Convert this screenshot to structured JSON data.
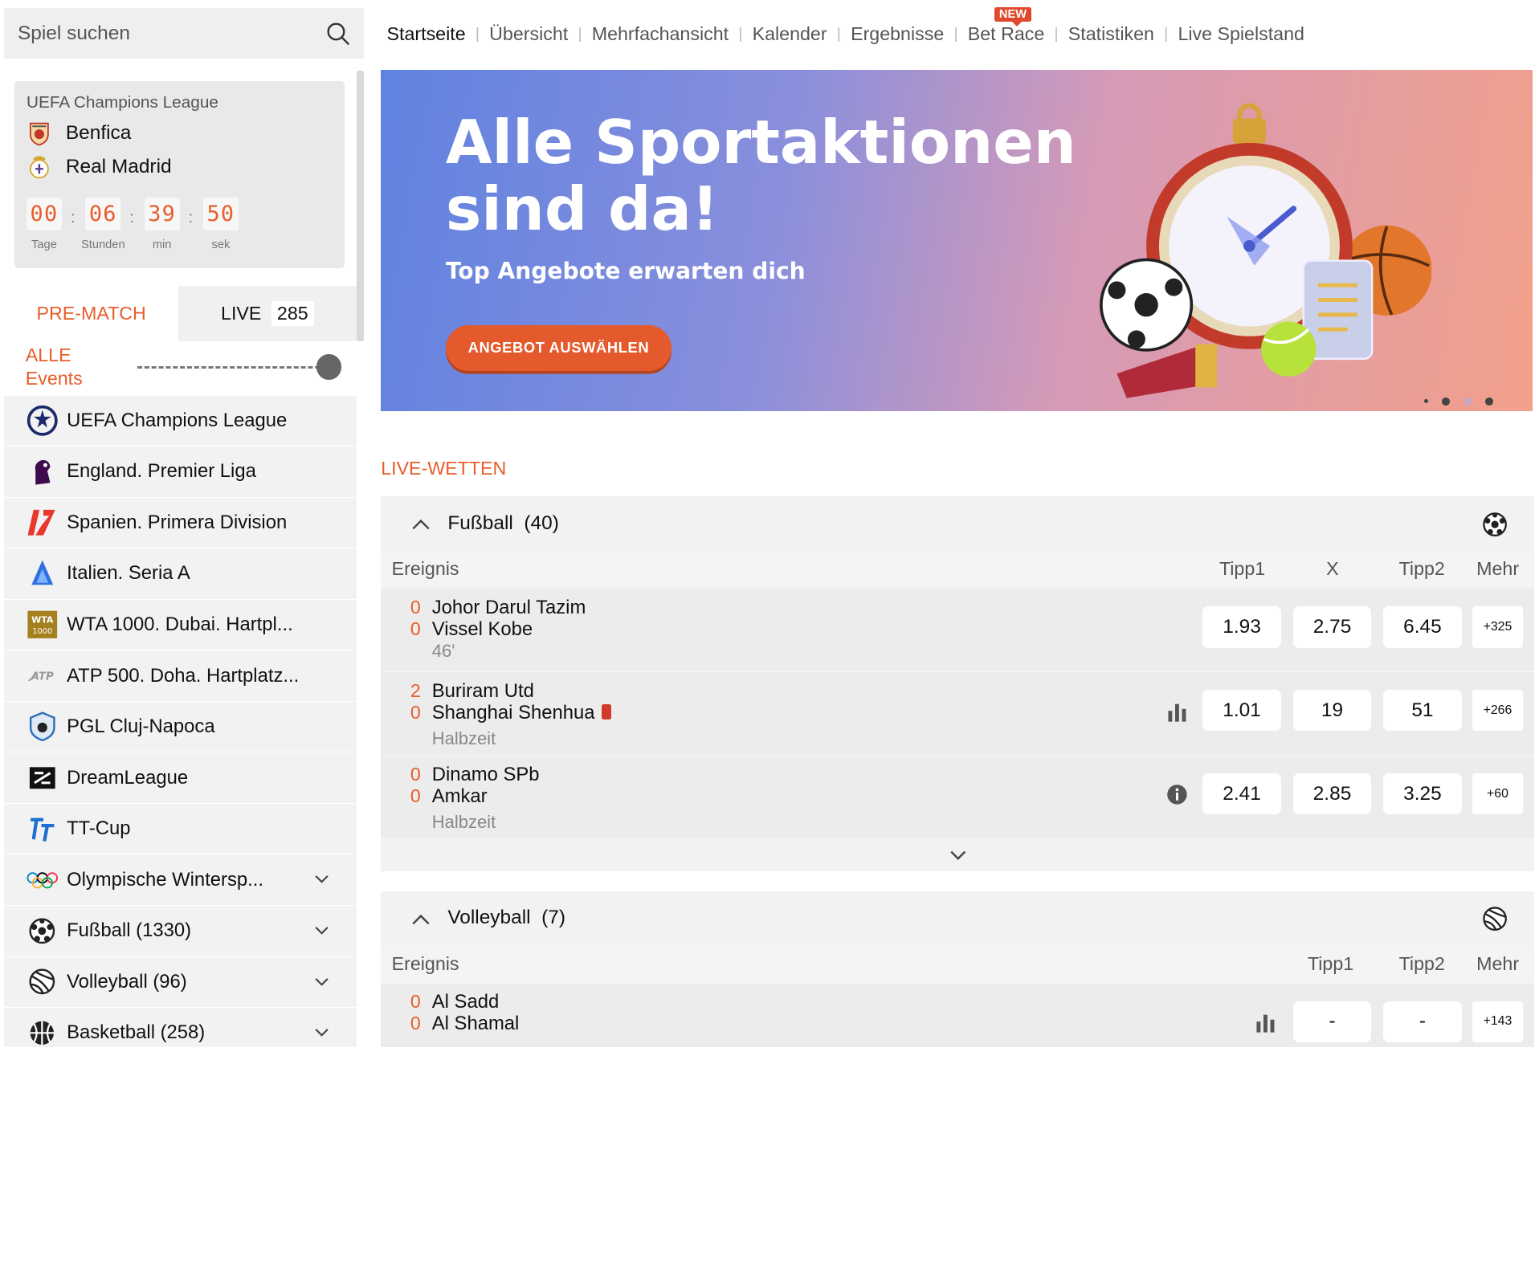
{
  "search": {
    "placeholder": "Spiel suchen"
  },
  "featured_match": {
    "league": "UEFA Champions League",
    "team1": "Benfica",
    "team2": "Real Madrid",
    "countdown": [
      {
        "value": "00",
        "label": "Tage"
      },
      {
        "value": "06",
        "label": "Stunden"
      },
      {
        "value": "39",
        "label": "min"
      },
      {
        "value": "50",
        "label": "sek"
      }
    ],
    "separator": ":"
  },
  "tabs": {
    "prematch": "PRE-MATCH",
    "live": "LIVE",
    "live_count": "285"
  },
  "filter": {
    "line1": "ALLE",
    "line2": "Events"
  },
  "leagues": [
    {
      "label": "UEFA Champions League",
      "icon": "champions-league-icon"
    },
    {
      "label": "England. Premier Liga",
      "icon": "premier-league-icon"
    },
    {
      "label": "Spanien. Primera Division",
      "icon": "laliga-icon"
    },
    {
      "label": "Italien. Seria A",
      "icon": "serie-a-icon"
    },
    {
      "label": "WTA 1000. Dubai. Hartpl...",
      "icon": "wta-icon"
    },
    {
      "label": "ATP 500. Doha. Hartplatz...",
      "icon": "atp-icon"
    },
    {
      "label": "PGL Cluj-Napoca",
      "icon": "pgl-icon"
    },
    {
      "label": "DreamLeague",
      "icon": "dreamleague-icon"
    },
    {
      "label": "TT-Cup",
      "icon": "tt-cup-icon"
    },
    {
      "label": "Olympische Wintersp...",
      "icon": "olympic-rings-icon",
      "expandable": true
    },
    {
      "label": "Fußball (1330)",
      "icon": "soccer-ball-icon",
      "expandable": true
    },
    {
      "label": "Volleyball (96)",
      "icon": "volleyball-icon",
      "expandable": true
    },
    {
      "label": "Basketball (258)",
      "icon": "basketball-icon",
      "expandable": true
    }
  ],
  "nav": {
    "items": [
      "Startseite",
      "Übersicht",
      "Mehrfachansicht",
      "Kalender",
      "Ergebnisse",
      "Bet Race",
      "Statistiken",
      "Live Spielstand"
    ],
    "badge": "NEW",
    "separator": "|"
  },
  "banner": {
    "title_line1": "Alle Sportaktionen",
    "title_line2": "sind da!",
    "subtitle": "Top Angebote erwarten dich",
    "cta": "ANGEBOT AUSWÄHLEN"
  },
  "live_section": {
    "title": "LIVE-WETTEN"
  },
  "football": {
    "name": "Fußball",
    "count": "(40)",
    "columns": {
      "event": "Ereignis",
      "tipp1": "Tipp1",
      "x": "X",
      "tipp2": "Tipp2",
      "more": "Mehr"
    },
    "events": [
      {
        "score1": "0",
        "score2": "0",
        "team1": "Johor Darul Tazim",
        "team2": "Vissel Kobe",
        "status": "46'",
        "odds": [
          "1.93",
          "2.75",
          "6.45"
        ],
        "more": "+325",
        "extra_icon": ""
      },
      {
        "score1": "2",
        "score2": "0",
        "team1": "Buriram Utd",
        "team2": "Shanghai Shenhua",
        "status": "Halbzeit",
        "odds": [
          "1.01",
          "19",
          "51"
        ],
        "more": "+266",
        "extra_icon": "stats-icon"
      },
      {
        "score1": "0",
        "score2": "0",
        "team1": "Dinamo SPb",
        "team2": "Amkar",
        "status": "Halbzeit",
        "odds": [
          "2.41",
          "2.85",
          "3.25"
        ],
        "more": "+60",
        "extra_icon": "info-icon"
      }
    ]
  },
  "volleyball": {
    "name": "Volleyball",
    "count": "(7)",
    "columns": {
      "event": "Ereignis",
      "tipp1": "Tipp1",
      "tipp2": "Tipp2",
      "more": "Mehr"
    },
    "events": [
      {
        "score1": "0",
        "score2": "0",
        "team1": "Al Sadd",
        "team2": "Al Shamal",
        "odds": [
          "-",
          "-"
        ],
        "more": "+143"
      }
    ]
  },
  "colors": {
    "accent": "#e85d2a",
    "badge": "#e0492d",
    "panel": "#f2f2f2"
  }
}
